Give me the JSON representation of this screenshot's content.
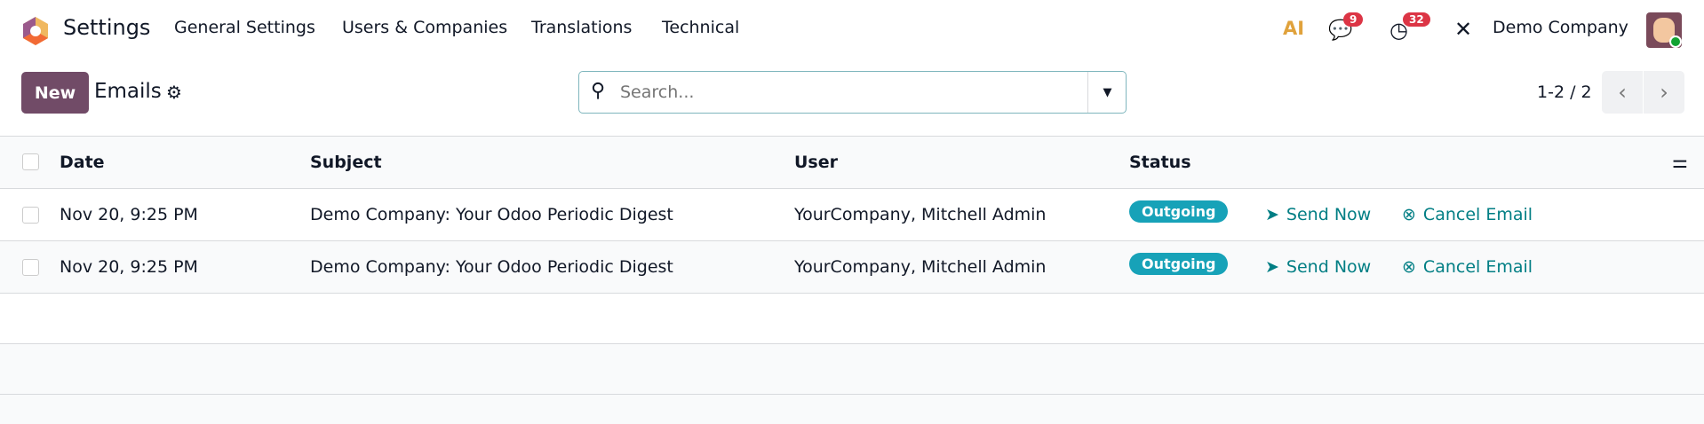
{
  "nav": {
    "app": "Settings",
    "menu": [
      "General Settings",
      "Users & Companies",
      "Translations",
      "Technical"
    ],
    "ai": "AI",
    "messages_count": "9",
    "activities_count": "32",
    "company": "Demo Company"
  },
  "control": {
    "new_label": "New",
    "title": "Emails",
    "search_placeholder": "Search...",
    "pager": "1-2 / 2"
  },
  "table": {
    "headers": [
      "Date",
      "Subject",
      "User",
      "Status"
    ],
    "rows": [
      {
        "date": "Nov 20, 9:25 PM",
        "subject": "Demo Company: Your Odoo Periodic Digest",
        "user": "YourCompany, Mitchell Admin",
        "status": "Outgoing",
        "send": "Send Now",
        "cancel": "Cancel Email"
      },
      {
        "date": "Nov 20, 9:25 PM",
        "subject": "Demo Company: Your Odoo Periodic Digest",
        "user": "YourCompany, Mitchell Admin",
        "status": "Outgoing",
        "send": "Send Now",
        "cancel": "Cancel Email"
      }
    ]
  },
  "colors": {
    "brand": "#714b67",
    "action": "#017e84",
    "badge": "#17a2b8"
  }
}
